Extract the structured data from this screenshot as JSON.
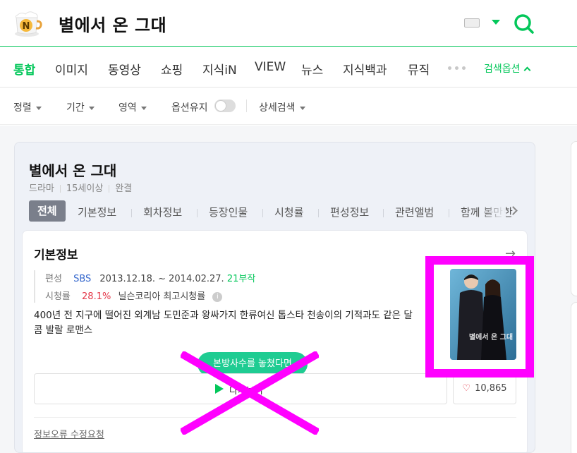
{
  "search": {
    "query": "별에서 온 그대",
    "logo_letter": "N"
  },
  "tabs": [
    {
      "label": "통합",
      "active": true
    },
    {
      "label": "이미지"
    },
    {
      "label": "동영상"
    },
    {
      "label": "쇼핑"
    },
    {
      "label": "지식iN"
    },
    {
      "label": "VIEW"
    },
    {
      "label": "뉴스"
    },
    {
      "label": "지식백과"
    },
    {
      "label": "뮤직"
    }
  ],
  "search_options_label": "검색옵션",
  "filters": {
    "sort": "정렬",
    "period": "기간",
    "area": "영역",
    "keep_options": "옵션유지",
    "keep_options_on": false,
    "advanced": "상세검색"
  },
  "card": {
    "title": "별에서 온 그대",
    "meta": [
      "드라마",
      "15세이상",
      "완결"
    ],
    "subtabs": [
      "전체",
      "기본정보",
      "회차정보",
      "등장인물",
      "시청률",
      "편성정보",
      "관련앨범",
      "함께 볼만한"
    ]
  },
  "info": {
    "title": "기본정보",
    "broadcast_label": "편성",
    "network": "SBS",
    "dates": "2013.12.18. ~ 2014.02.27.",
    "episodes": "21부작",
    "rating_label": "시청률",
    "rating_value": "28.1%",
    "rating_note": "닐슨코리아 최고시청률",
    "synopsis": "400년 전 지구에 떨어진 외계남 도민준과 왕싸가지 한류여신 톱스타 천송이의 기적과도 같은 달콤 발랄 로맨스",
    "poster_caption": "별에서 온 그대",
    "promo_text": "본방사수를 놓쳤다면",
    "watch_label": "다시보기",
    "likes": "10,865",
    "report_label": "정보오류 수정요청"
  },
  "colors": {
    "brand_green": "#03c75a",
    "highlight": "#ff00ff",
    "rating_red": "#e4394a"
  }
}
